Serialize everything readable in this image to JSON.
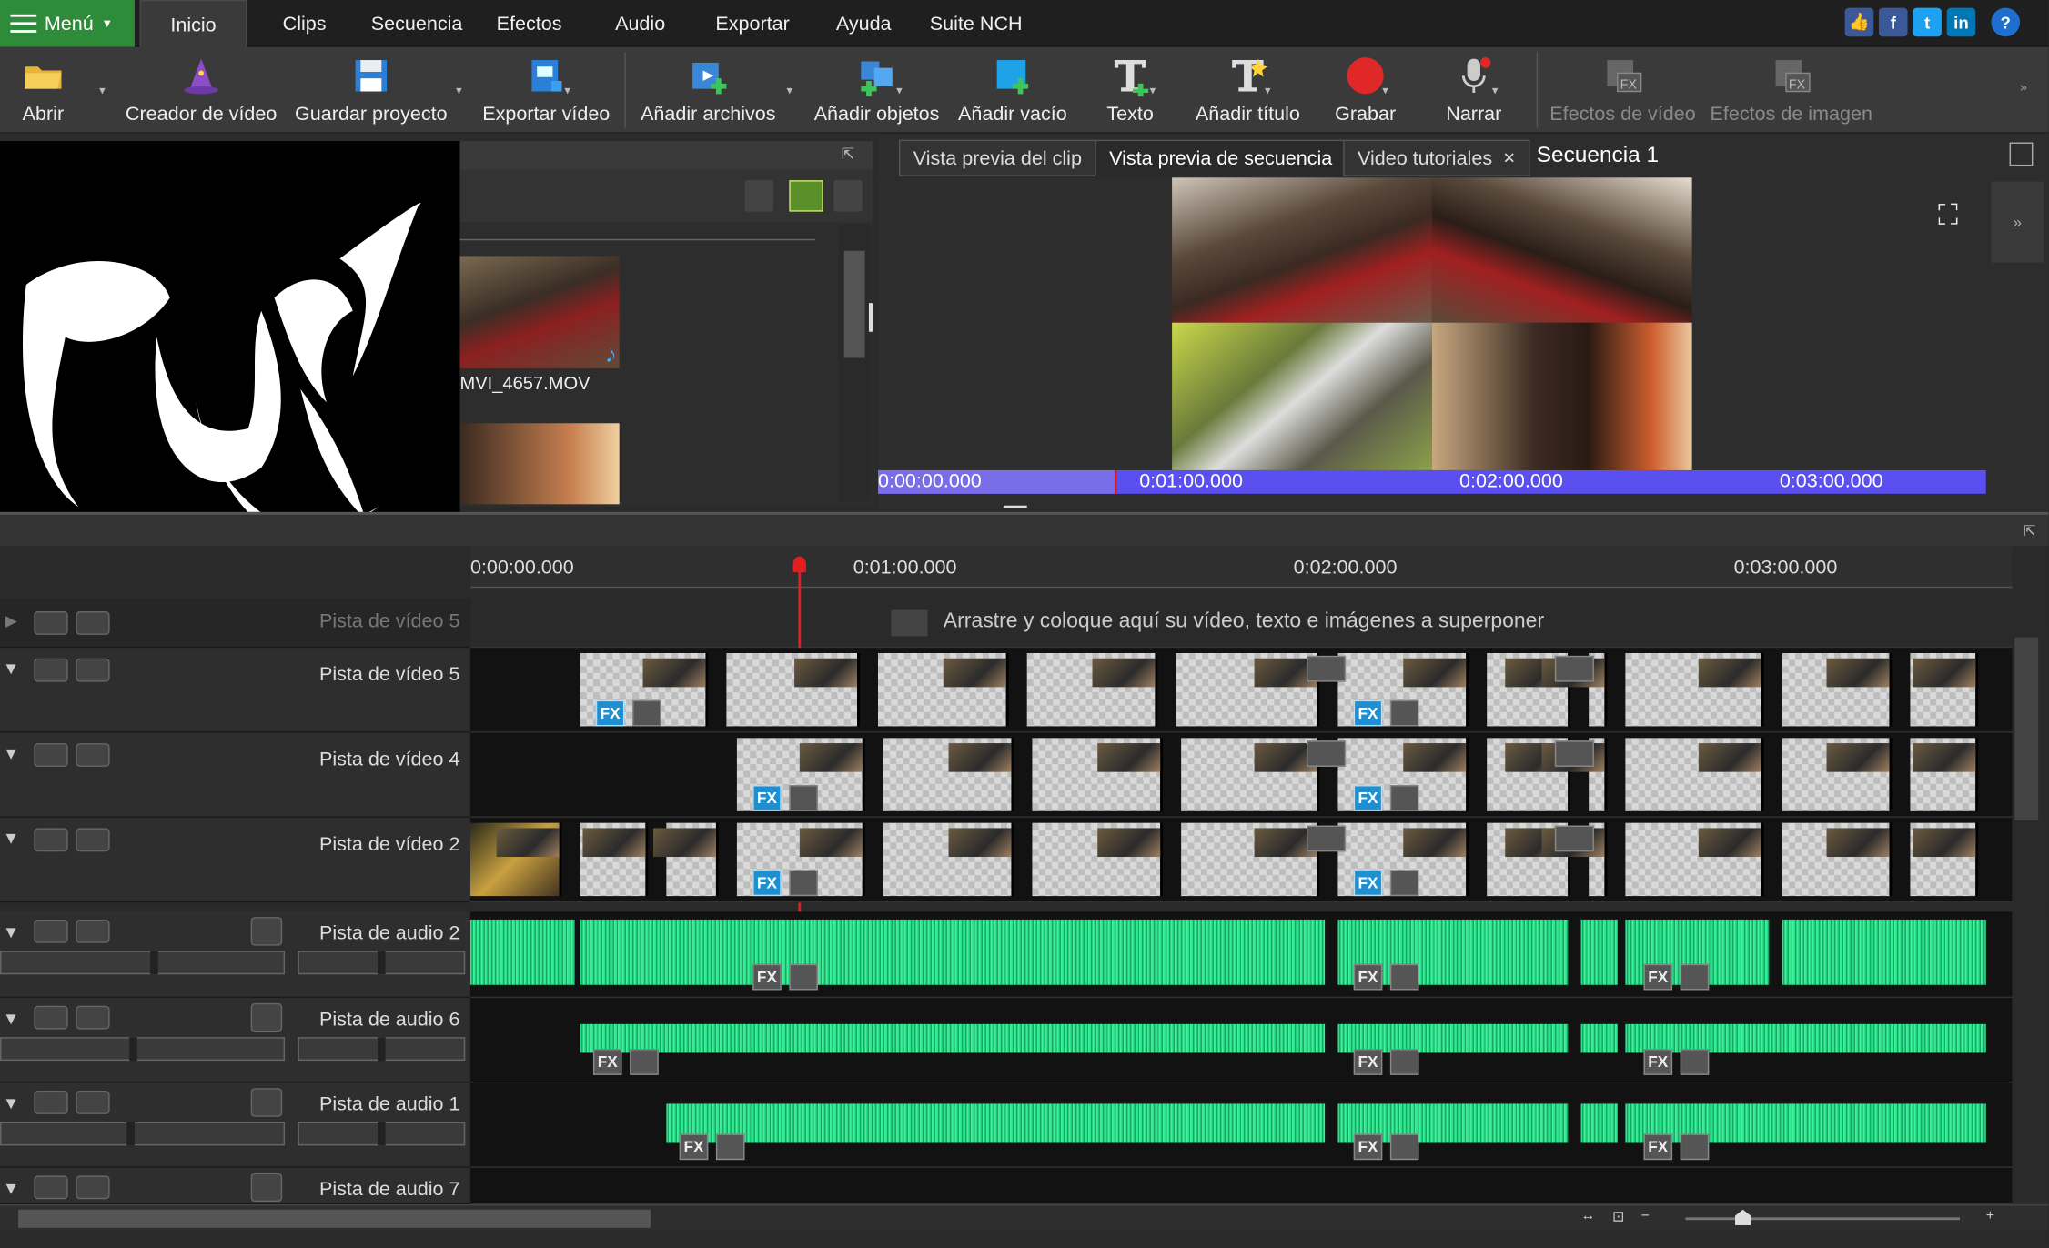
{
  "menubar": {
    "menu_label": "Menú",
    "tabs": [
      "Inicio",
      "Clips",
      "Secuencia",
      "Efectos",
      "Audio",
      "Exportar",
      "Ayuda",
      "Suite NCH"
    ]
  },
  "toolbar": {
    "items": [
      "Abrir",
      "Creador de vídeo",
      "Guardar proyecto",
      "Exportar vídeo",
      "Añadir archivos",
      "Añadir objetos",
      "Añadir vacío",
      "Texto",
      "Añadir título",
      "Grabar",
      "Narrar",
      "Efectos de vídeo",
      "Efectos de imagen"
    ]
  },
  "bin": {
    "file_name": "MVI_4657.MOV"
  },
  "preview": {
    "tabs": [
      "Vista previa del clip",
      "Vista previa de secuencia",
      "Video tutoriales"
    ],
    "sequence_title": "Secuencia 1",
    "scrub_times": [
      "0:00:00.000",
      "0:01:00.000",
      "0:02:00.000",
      "0:03:00.000"
    ]
  },
  "timeline": {
    "ruler_times": [
      "0:00:00.000",
      "0:01:00.000",
      "0:02:00.000",
      "0:03:00.000"
    ],
    "overlay_track": "Pista de vídeo 5",
    "drop_hint": "Arrastre y coloque aquí su vídeo, texto e imágenes a superponer",
    "video_tracks": [
      "Pista de vídeo 5",
      "Pista de vídeo 4",
      "Pista de vídeo 2"
    ],
    "audio_tracks": [
      "Pista de audio 2",
      "Pista de audio 6",
      "Pista de audio 1",
      "Pista de audio 7"
    ]
  },
  "colors": {
    "menu_green": "#2e8b3a",
    "fx_blue": "#1e8fd0",
    "wave_green": "#2ee08a",
    "scrub_purple": "#5a4ff0",
    "playhead": "#e02020"
  }
}
